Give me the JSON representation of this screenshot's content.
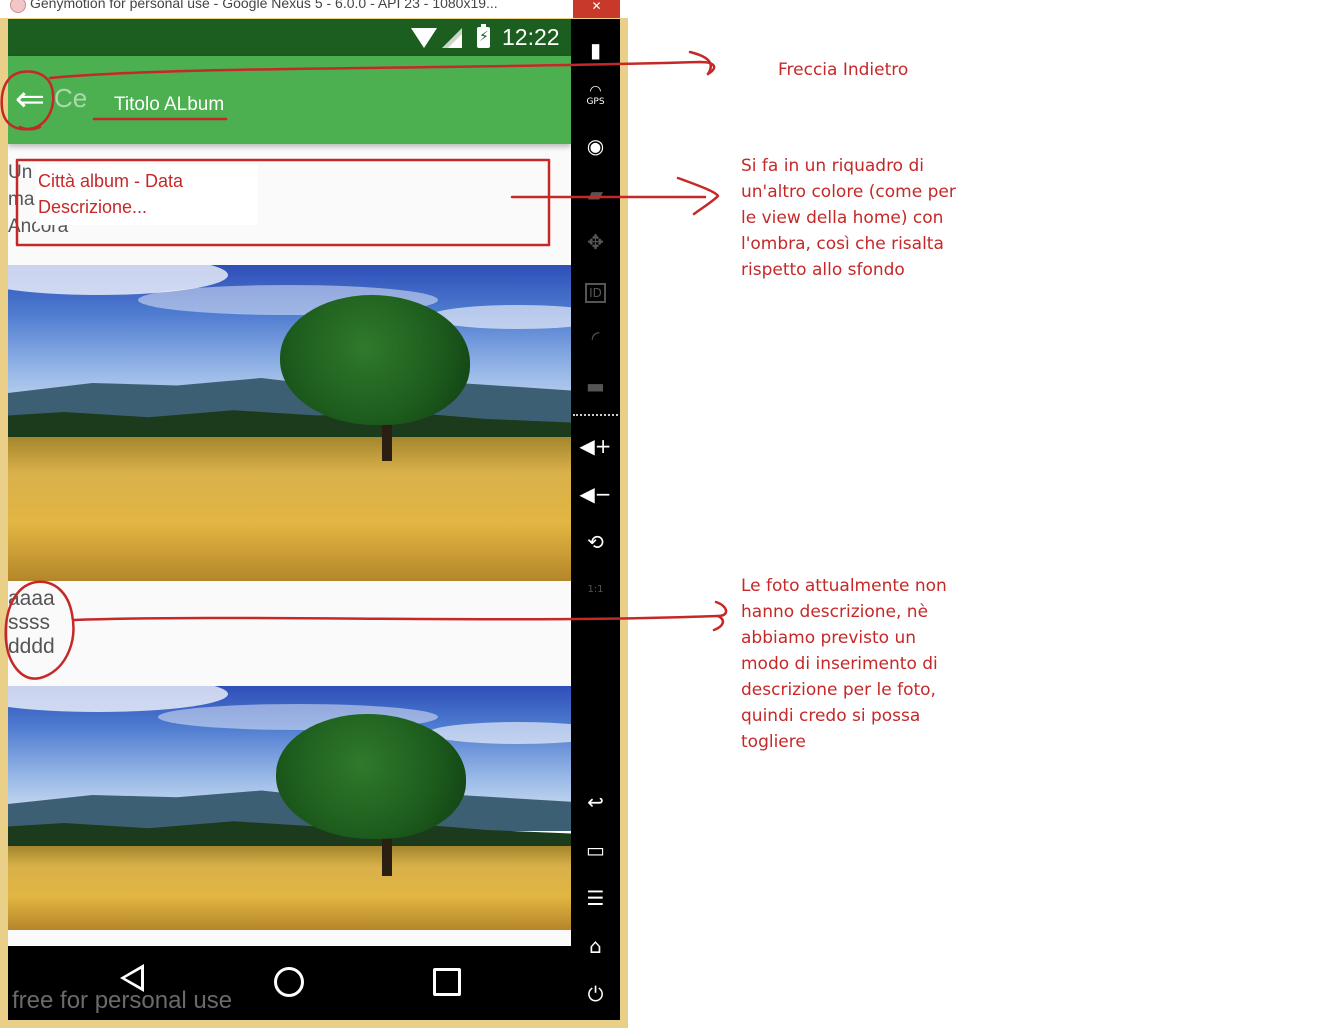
{
  "window": {
    "title": "Genymotion for personal use - Google Nexus 5 - 6.0.0 - API 23 - 1080x19...",
    "close_icon": "close-icon"
  },
  "statusbar": {
    "time": "12:22",
    "icons": [
      "wifi-icon",
      "signal-icon",
      "battery-charging-icon"
    ]
  },
  "appbar": {
    "back_icon": "back-arrow-icon",
    "hidden_title": "Ce",
    "annotated_title": "Titolo ALbum"
  },
  "album": {
    "description_lines": [
      "Un",
      "ma",
      "Ancora"
    ],
    "overlay_lines": [
      "Città album - Data",
      "Descrizione..."
    ]
  },
  "photos": [
    {
      "caption_lines": [
        "aaaa",
        "ssss",
        "dddd"
      ]
    },
    {
      "caption_lines": []
    }
  ],
  "navbar": {
    "icons": [
      "nav-back-icon",
      "nav-home-icon",
      "nav-recents-icon"
    ],
    "watermark": "free for personal use"
  },
  "sidebar": {
    "top_icons": [
      "battery-icon",
      "gps-icon",
      "camera-icon",
      "clapperboard-icon",
      "move-icon",
      "id-icon",
      "rss-icon",
      "sms-icon"
    ],
    "gps_label": "GPS",
    "id_label": "ID",
    "scale_label": "1:1",
    "mid_icons": [
      "volume-up-icon",
      "volume-down-icon",
      "rotate-icon",
      "pixel-perfect-icon"
    ],
    "bottom_icons": [
      "back-icon",
      "recent-apps-icon",
      "menu-icon",
      "home-icon",
      "power-icon"
    ]
  },
  "annotations": {
    "back_arrow": "Freccia Indietro",
    "box_note": [
      "Si fa in un riquadro di",
      "un'altro colore (come per",
      "le view della home) con",
      "l'ombra, così che risalta",
      "rispetto allo sfondo"
    ],
    "photo_note": [
      "Le foto attualmente non",
      "hanno descrizione, nè",
      "abbiamo previsto un",
      "modo di inserimento di",
      "descrizione per le foto,",
      "quindi credo si possa",
      "togliere"
    ]
  },
  "colors": {
    "statusbar": "#1b5e20",
    "appbar": "#4caf50",
    "annotation": "#c62828",
    "frame": "#e9cf87"
  }
}
